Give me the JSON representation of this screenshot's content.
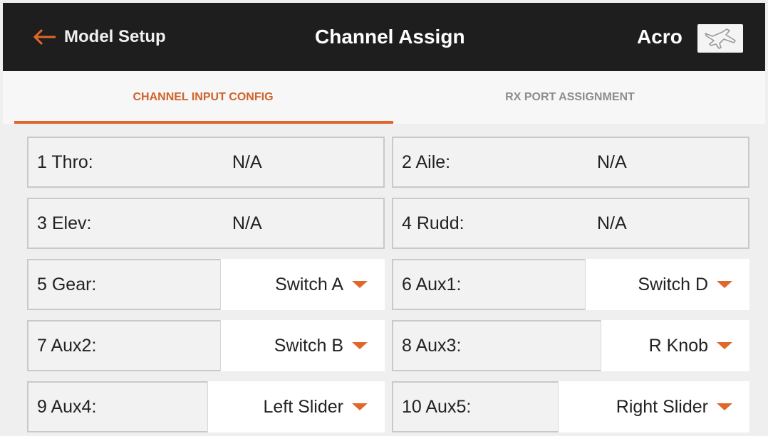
{
  "header": {
    "back_label": "Model Setup",
    "title": "Channel Assign",
    "model_type": "Acro",
    "model_icon": "airplane-icon"
  },
  "tabs": [
    {
      "label": "CHANNEL INPUT CONFIG",
      "active": true
    },
    {
      "label": "RX PORT ASSIGNMENT",
      "active": false
    }
  ],
  "channels": {
    "c1": {
      "label": "1 Thro:",
      "value": "N/A"
    },
    "c2": {
      "label": "2 Aile:",
      "value": "N/A"
    },
    "c3": {
      "label": "3 Elev:",
      "value": "N/A"
    },
    "c4": {
      "label": "4 Rudd:",
      "value": "N/A"
    },
    "c5": {
      "label": "5 Gear:",
      "value": "Switch A"
    },
    "c6": {
      "label": "6 Aux1:",
      "value": "Switch D"
    },
    "c7": {
      "label": "7 Aux2:",
      "value": "Switch B"
    },
    "c8": {
      "label": "8 Aux3:",
      "value": "R Knob"
    },
    "c9": {
      "label": "9 Aux4:",
      "value": "Left Slider"
    },
    "c10": {
      "label": "10 Aux5:",
      "value": "Right Slider"
    }
  },
  "colors": {
    "accent": "#e0672b",
    "header_bg": "#1e1e1e",
    "inactive_tab": "#8d8d8d"
  }
}
